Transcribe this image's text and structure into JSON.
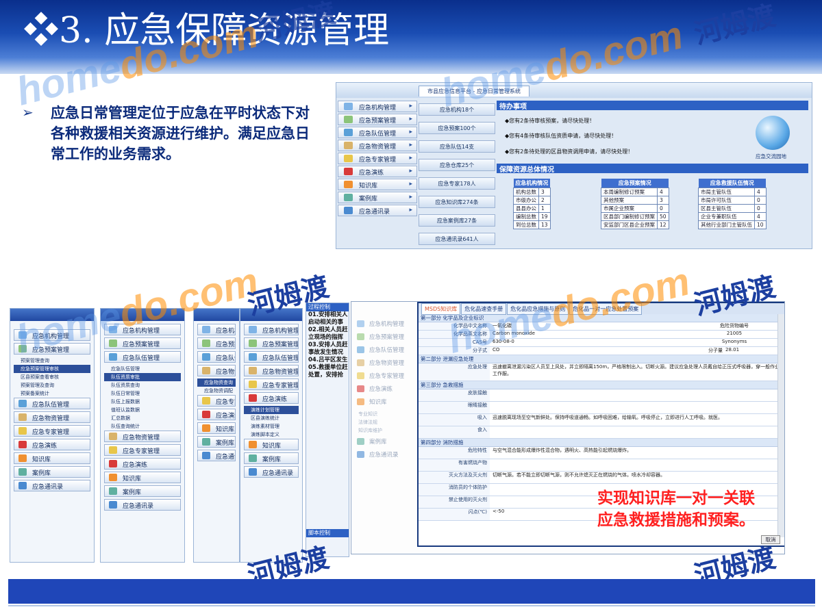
{
  "slide": {
    "title": "❖3. 应急保障资源管理",
    "bullet_symbol": "➢",
    "bullet_text": "应急日常管理定位于应急在平时状态下对各种救援相关资源进行维护。满足应急日常工作的业务需求。",
    "callout": [
      "实现知识库一对一关联",
      "应急救援措施和预案。"
    ]
  },
  "watermarks": {
    "zh": "河姆渡",
    "en_a": "home",
    "en_b": "do.com"
  },
  "dashboard": {
    "tab": "市县应急信息平台 - 应急日常管理系统",
    "menu": [
      "应急机构管理",
      "应急预案管理",
      "应急队伍管理",
      "应急物资管理",
      "应急专家管理",
      "应急演练",
      "知识库",
      "案例库",
      "应急通讯录"
    ],
    "stats": [
      "应急机构18个",
      "应急预案100个",
      "应急队伍14支",
      "应急仓库25个",
      "应急专家178人",
      "应急知识库274条",
      "应急案例库27条",
      "应急通讯录641人"
    ],
    "todo_title": "待办事项",
    "todo": [
      "◆您有2条待审核预案，请尽快处理！",
      "◆您有4条待审核队伍资质申请，请尽快处理！",
      "◆您有2条待处理的区县物资调用申请，请尽快处理！"
    ],
    "exchange": "应急交流园地",
    "res_title": "保障资源总体情况",
    "tables": [
      {
        "head": "应急机构情况",
        "rows": [
          [
            "机构总数",
            "3"
          ],
          [
            "市级办公",
            "2"
          ],
          [
            "县县办公",
            "1"
          ],
          [
            "编制总数",
            "19"
          ],
          [
            "到位总数",
            "13"
          ]
        ]
      },
      {
        "head": "应急预案情况",
        "rows": [
          [
            "本周编制修订预案",
            "4"
          ],
          [
            "其他预案",
            "3"
          ],
          [
            "市属企业预案",
            "0"
          ],
          [
            "区县部门编制修订预案",
            "50"
          ],
          [
            "安监部门区县企业预案",
            "12"
          ]
        ]
      },
      {
        "head": "应急救援队伍情况",
        "rows": [
          [
            "市局主管队伍",
            "4"
          ],
          [
            "市局许可队伍",
            "0"
          ],
          [
            "区县主管队伍",
            "0"
          ],
          [
            "企业专兼职队伍",
            "4"
          ],
          [
            "其他行业部门主管队伍",
            "10"
          ]
        ]
      }
    ]
  },
  "panel_a": {
    "menu": [
      "应急机构管理",
      "应急预案管理"
    ],
    "subs": [
      "预案管理查询",
      "应急预案管理审核",
      "区县预案查看审核",
      "预案管理及查询",
      "预案备案统计"
    ],
    "menu_b": [
      "应急队伍管理",
      "应急物资管理",
      "应急专家管理",
      "应急演练",
      "知识库",
      "案例库",
      "应急通讯录"
    ]
  },
  "panel_b": {
    "menu": [
      "应急机构管理",
      "应急预案管理",
      "应急队伍管理"
    ],
    "subs": [
      "应急队伍管理",
      "队伍资质审批",
      "队伍资质查询",
      "队伍日常管理",
      "队伍上报数据",
      "值班认监数据",
      "汇总数据",
      "队伍查询统计"
    ],
    "menu_b": [
      "应急物资管理",
      "应急专家管理",
      "应急演练",
      "知识库",
      "案例库",
      "应急通讯录"
    ]
  },
  "panel_c": {
    "menu": [
      "应急机构",
      "应急预案",
      "应急队伍",
      "应急物资",
      "应急物资查询",
      "应急物资调配",
      "应急专家",
      "应急演练",
      "知识库",
      "案例库",
      "应急通讯"
    ]
  },
  "panel_d": {
    "menu": [
      "应急机构管理",
      "应急预案管理",
      "应急队伍管理",
      "应急物资管理",
      "应急专家管理",
      "应急演练"
    ],
    "subs": [
      "演练计划管理",
      "区县演练统计",
      "演练素材管理",
      "演练脚本定义"
    ],
    "menu_b": [
      "知识库",
      "案例库",
      "应急通讯录"
    ]
  },
  "script_panel": {
    "head": "过程控制",
    "lines": [
      "01.安排相关人",
      "启动相关的事",
      "02.相关人员赶",
      "立现场的指挥",
      "03.安排人员赶",
      "事故发生情况",
      "04.吕平区发生",
      "05.救援单位赶",
      "处置，安排抢"
    ],
    "foot": "脚本控制"
  },
  "kb": {
    "side": [
      "应急机构管理",
      "应急预案管理",
      "应急队伍管理",
      "应急物资管理",
      "应急专家管理",
      "应急演练",
      "知识库",
      "案例库",
      "应急通讯录"
    ],
    "side_subs": [
      "专业知识",
      "法律法规",
      "知识库维护"
    ],
    "tabs": [
      "MSDS知识库",
      "危化品速查手册",
      "危化品应急措施与原则",
      "危化品一对一应急处置预案"
    ],
    "sections": [
      {
        "title": "第一部分 化学品及企业标识",
        "rows": [
          [
            "化学品中文名称",
            "一氧化碳"
          ],
          [
            "化学品英文名称",
            "Carbon monoxide"
          ],
          [
            "CAS号",
            "630-08-0"
          ],
          [
            "分子式",
            "CO"
          ]
        ]
      },
      {
        "title": "第二部分 泄漏应急处理",
        "rows": [
          [
            "应急处理",
            "迅速撤离泄漏污染区人员至上风处，并立即隔离150m，严格限制出入。切断火源。建议应急处理人员戴自给正压式呼吸器，穿一般作业工作服。"
          ]
        ]
      },
      {
        "title": "第三部分 急救措施",
        "rows": [
          [
            "皮肤接触",
            ""
          ],
          [
            "眼睛接触",
            ""
          ],
          [
            "吸入",
            "迅速脱离现场至空气新鲜处。保持呼吸道通畅。如呼吸困难，给输氧。呼吸停止，立即进行人工呼吸。就医。"
          ],
          [
            "食入",
            ""
          ]
        ]
      },
      {
        "title": "第四部分 消防措施",
        "rows": [
          [
            "危险特性",
            "与空气混合能形成爆炸性混合物，遇明火、高热能引起燃烧爆炸。"
          ],
          [
            "有害燃烧产物",
            ""
          ],
          [
            "灭火方法及灭火剂",
            "切断气源。若不能立即切断气源，则不允许熄灭正在燃烧的气体。喷水冷却容器。"
          ],
          [
            "消防员的个体防护",
            ""
          ],
          [
            "禁止使用的灭火剂",
            ""
          ],
          [
            "闪点(℃)",
            "<-50"
          ]
        ]
      }
    ],
    "extra_label": "危险货物编号",
    "extra_value": "21005",
    "syn_label": "Synonyms",
    "mw_label": "分子量",
    "mw_value": "28.01",
    "cancel": "取消"
  },
  "colors": {
    "accent": "#1f46b8",
    "callout": "#ff2020"
  }
}
